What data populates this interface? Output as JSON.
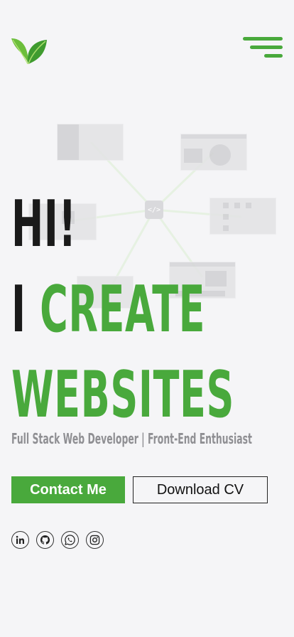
{
  "header": {
    "logo_icon": "leaf-logo-icon",
    "menu_icon": "hamburger-menu-icon"
  },
  "hero": {
    "greeting": "HI!",
    "line2_prefix": "I",
    "line2_highlight": "CREATE",
    "line3": "WEBSITES",
    "subtitle": "Full Stack Web Developer | Front-End Enthusiast",
    "hub_symbol": "</>"
  },
  "actions": {
    "contact_label": "Contact Me",
    "download_label": "Download CV"
  },
  "socials": [
    {
      "icon": "linkedin-icon"
    },
    {
      "icon": "github-icon"
    },
    {
      "icon": "whatsapp-icon"
    },
    {
      "icon": "instagram-icon"
    }
  ],
  "colors": {
    "accent": "#49a93c",
    "text_dark": "#1a1a1a",
    "subtitle": "#8f8f93",
    "background": "#f5f5f7"
  }
}
